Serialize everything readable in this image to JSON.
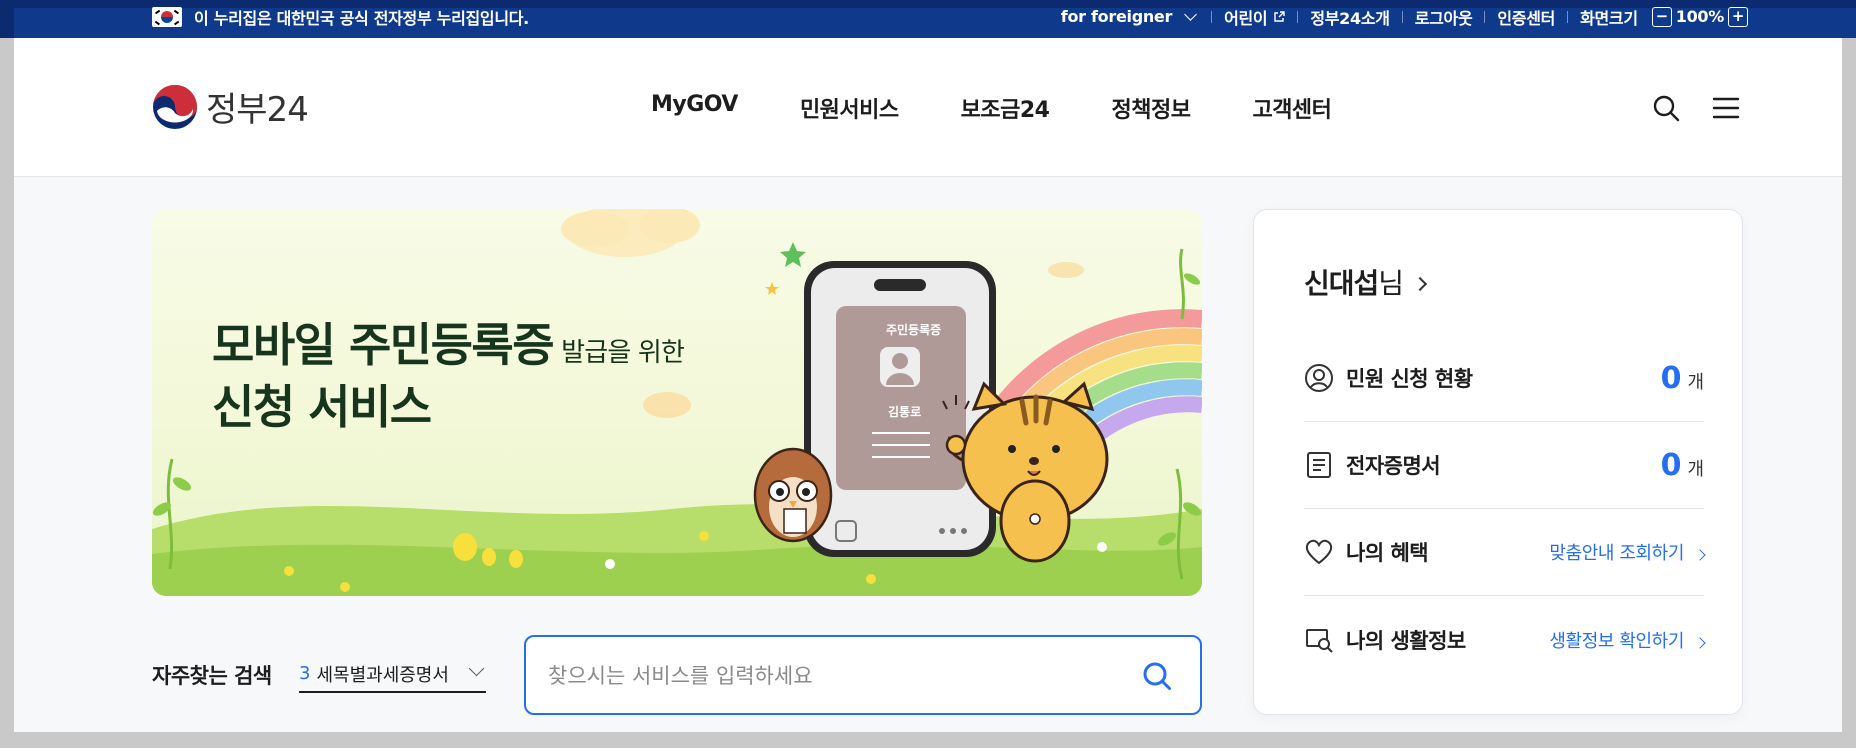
{
  "gov_banner": {
    "text": "이 누리집은 대한민국 공식 전자정부 누리집입니다.",
    "links": {
      "foreigner": "for foreigner",
      "kids": "어린이",
      "about": "정부24소개",
      "logout": "로그아웃",
      "cert": "인증센터",
      "screen_size": "화면크기",
      "zoom_minus": "−",
      "zoom_value": "100%",
      "zoom_plus": "+"
    }
  },
  "header": {
    "logo_text": "정부24",
    "nav": [
      "MyGOV",
      "민원서비스",
      "보조금24",
      "정책정보",
      "고객센터"
    ],
    "icons": [
      "search-icon",
      "menu-icon"
    ]
  },
  "banner": {
    "title_line1": "모바일 주민등록증",
    "title_sub": "발급을 위한",
    "title_line2": "신청 서비스",
    "card_title": "주민등록증",
    "card_name": "김통로"
  },
  "search": {
    "frequent_label": "자주찾는 검색",
    "frequent_rank": "3",
    "frequent_term": "세목별과세증명서",
    "placeholder": "찾으시는 서비스를 입력하세요"
  },
  "panel": {
    "user_name": "신대섭",
    "user_suffix": "님",
    "rows": [
      {
        "icon": "user-circle-icon",
        "label": "민원 신청 현황",
        "count": "0",
        "unit": "개"
      },
      {
        "icon": "document-icon",
        "label": "전자증명서",
        "count": "0",
        "unit": "개"
      },
      {
        "icon": "heart-icon",
        "label": "나의 혜택",
        "link": "맞춤안내 조회하기"
      },
      {
        "icon": "life-info-icon",
        "label": "나의 생활정보",
        "link": "생활정보 확인하기"
      }
    ]
  },
  "colors": {
    "gov_bar": "#0b2a6f",
    "accent": "#256ef4",
    "banner_bg": "#f3f8d8"
  }
}
